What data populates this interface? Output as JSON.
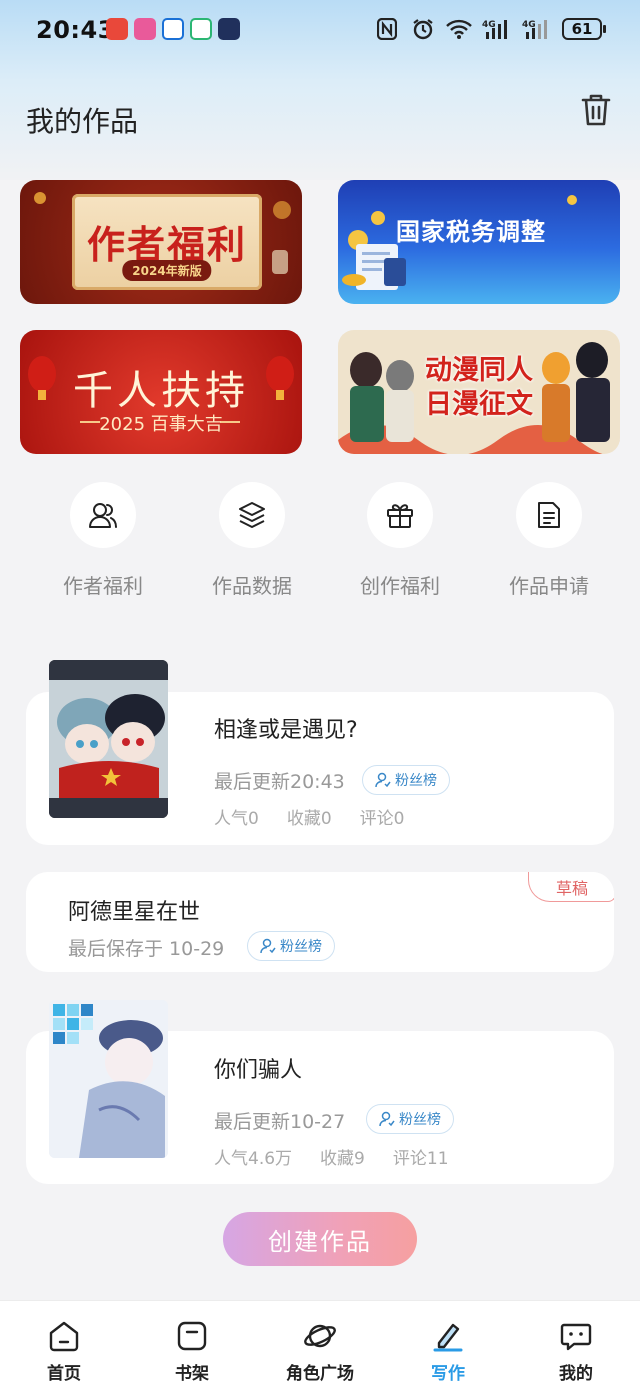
{
  "status_bar": {
    "time": "20:43",
    "battery": "61"
  },
  "header": {
    "title": "我的作品"
  },
  "banners": {
    "author_welfare": {
      "title": "作者福利",
      "tag": "2024年新版"
    },
    "tax": {
      "title": "国家税务调整"
    },
    "thousand_support": {
      "title": "千人扶持",
      "subtitle": "2025 百事大吉"
    },
    "anime": {
      "title": "动漫同人日漫征文"
    }
  },
  "quick_actions": [
    {
      "label": "作者福利"
    },
    {
      "label": "作品数据"
    },
    {
      "label": "创作福利"
    },
    {
      "label": "作品申请"
    }
  ],
  "works": [
    {
      "title": "相逢或是遇见?",
      "updated": "最后更新20:43",
      "fan_label": "粉丝榜",
      "popularity": "人气0",
      "favorites": "收藏0",
      "comments": "评论0"
    },
    {
      "title": "阿德里星在世",
      "saved": "最后保存于 10-29",
      "fan_label": "粉丝榜",
      "badge": "草稿"
    },
    {
      "title": "你们骗人",
      "updated": "最后更新10-27",
      "fan_label": "粉丝榜",
      "popularity": "人气4.6万",
      "favorites": "收藏9",
      "comments": "评论11"
    }
  ],
  "create_button": "创建作品",
  "tabs": [
    {
      "label": "首页"
    },
    {
      "label": "书架"
    },
    {
      "label": "角色广场"
    },
    {
      "label": "写作"
    },
    {
      "label": "我的"
    }
  ],
  "colors": {
    "accent": "#2a9be6",
    "draft": "#e06464",
    "fan_text": "#3a88c8"
  }
}
